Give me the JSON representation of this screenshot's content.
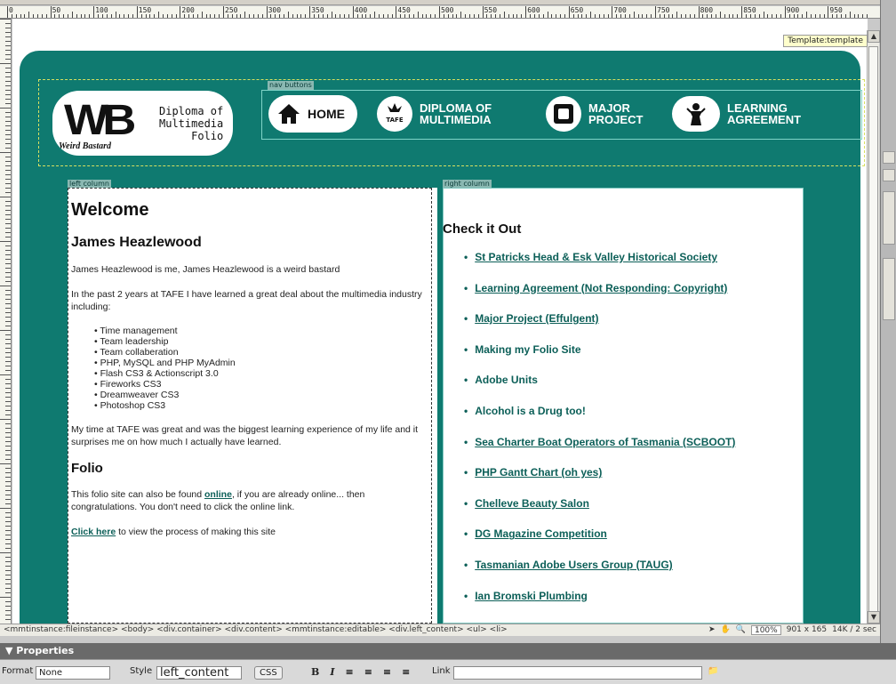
{
  "ruler": {
    "labels": [
      "0",
      "50",
      "100",
      "150",
      "200",
      "250",
      "300",
      "350",
      "400",
      "450",
      "500",
      "550",
      "600",
      "650",
      "700",
      "750",
      "800",
      "850",
      "900",
      "950"
    ]
  },
  "template_tag": "Template:template",
  "region_labels": {
    "nav": "nav buttons",
    "left": "left column",
    "right": "right column"
  },
  "logo": {
    "letters": "WB",
    "tagline": "Weird Bastard",
    "title_lines": "Diploma of\nMultimedia\nFolio"
  },
  "nav": [
    {
      "label": "HOME",
      "icon": "house-icon"
    },
    {
      "label": "DIPLOMA OF\nMULTIMEDIA",
      "icon": "tafe-logo-icon"
    },
    {
      "label": "MAJOR\nPROJECT",
      "icon": "square-icon"
    },
    {
      "label": "LEARNING\nAGREEMENT",
      "icon": "figure-icon"
    }
  ],
  "left": {
    "welcome": "Welcome",
    "name": "James Heazlewood",
    "intro": "James Heazlewood is me, James Heazlewood  is a weird bastard",
    "learned": "In the past 2 years at TAFE I have learned a great deal about the multimedia industry including:",
    "skills": [
      "Time management",
      "Team leadership",
      "Team collaberation",
      "PHP, MySQL and PHP MyAdmin",
      "Flash CS3 & Actionscript 3.0",
      "Fireworks CS3",
      "Dreamweaver CS3",
      "Photoshop CS3"
    ],
    "time_at_tafe": "My time at TAFE was great and was the biggest learning experience of my life and it surprises me on how much I actually have learned.",
    "folio_heading": "Folio",
    "folio_pre": "This folio site can also be found ",
    "folio_link": "online",
    "folio_post": ", if you are already online... then congratulations. You don't need to click the online link.",
    "click_link": "Click here",
    "click_post": " to view the process of making this site"
  },
  "right": {
    "heading": "Check it Out",
    "links": [
      {
        "text": "St Patricks Head & Esk Valley Historical Society",
        "linked": true
      },
      {
        "text": "Learning Agreement (Not Responding: Copyright)",
        "linked": true
      },
      {
        "text": "Major Project (Effulgent)",
        "linked": true
      },
      {
        "text": "Making my Folio Site",
        "linked": false
      },
      {
        "text": "Adobe Units",
        "linked": false
      },
      {
        "text": "Alcohol is a Drug too!",
        "linked": false
      },
      {
        "text": "Sea Charter Boat Operators of Tasmania (SCBOOT)",
        "linked": true
      },
      {
        "text": "PHP Gantt Chart (oh yes)",
        "linked": true
      },
      {
        "text": "Chelleve Beauty Salon",
        "linked": true
      },
      {
        "text": "DG Magazine Competition",
        "linked": true
      },
      {
        "text": "Tasmanian Adobe Users Group (TAUG)",
        "linked": true
      },
      {
        "text": "Ian Bromski Plumbing",
        "linked": true
      }
    ]
  },
  "tagbar": {
    "path": "<mmtinstance:fileinstance> <body> <div.container> <div.content> <mmtinstance:editable> <div.left_content> <ul> <li>",
    "zoom": "100%",
    "size": "901 x 165",
    "weight": "14K / 2 sec"
  },
  "properties": {
    "title": "▼ Properties",
    "format_label": "Format",
    "format_value": "None",
    "style_label": "Style",
    "style_value": "left_content",
    "css_button": "CSS",
    "link_label": "Link"
  },
  "colors": {
    "teal": "#0f7a70",
    "link": "#0c5f58"
  }
}
